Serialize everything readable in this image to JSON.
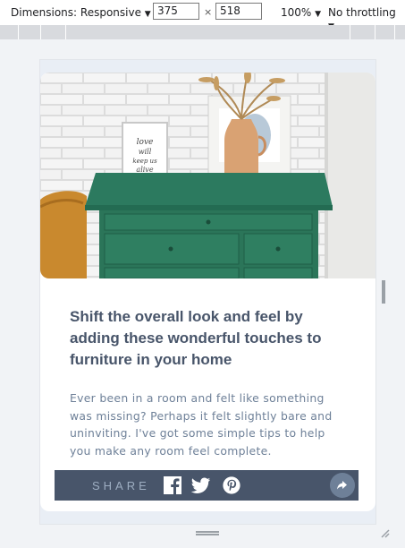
{
  "toolbar": {
    "dimensions_label": "Dimensions: Responsive",
    "width_value": "375",
    "times_symbol": "×",
    "height_value": "518",
    "zoom_label": "100%",
    "throttle_label": "No throttling",
    "caret": "▼"
  },
  "card": {
    "image_text": "love will keep us alive",
    "title": "Shift the overall look and feel by adding these wonderful touches to furniture in your home",
    "description": "Ever been in a room and felt like something was missing? Perhaps it felt slightly bare and uninviting. I've got some simple tips to help you make any room feel complete.",
    "share_label": "SHARE"
  },
  "icons": {
    "facebook": "facebook-icon",
    "twitter": "twitter-icon",
    "pinterest": "pinterest-icon",
    "share": "share-arrow-icon"
  },
  "colors": {
    "title": "#48556a",
    "description": "#6e8098",
    "share_bar": "#48556a",
    "share_button": "#6e8098",
    "page_bg": "#e9eef5"
  }
}
